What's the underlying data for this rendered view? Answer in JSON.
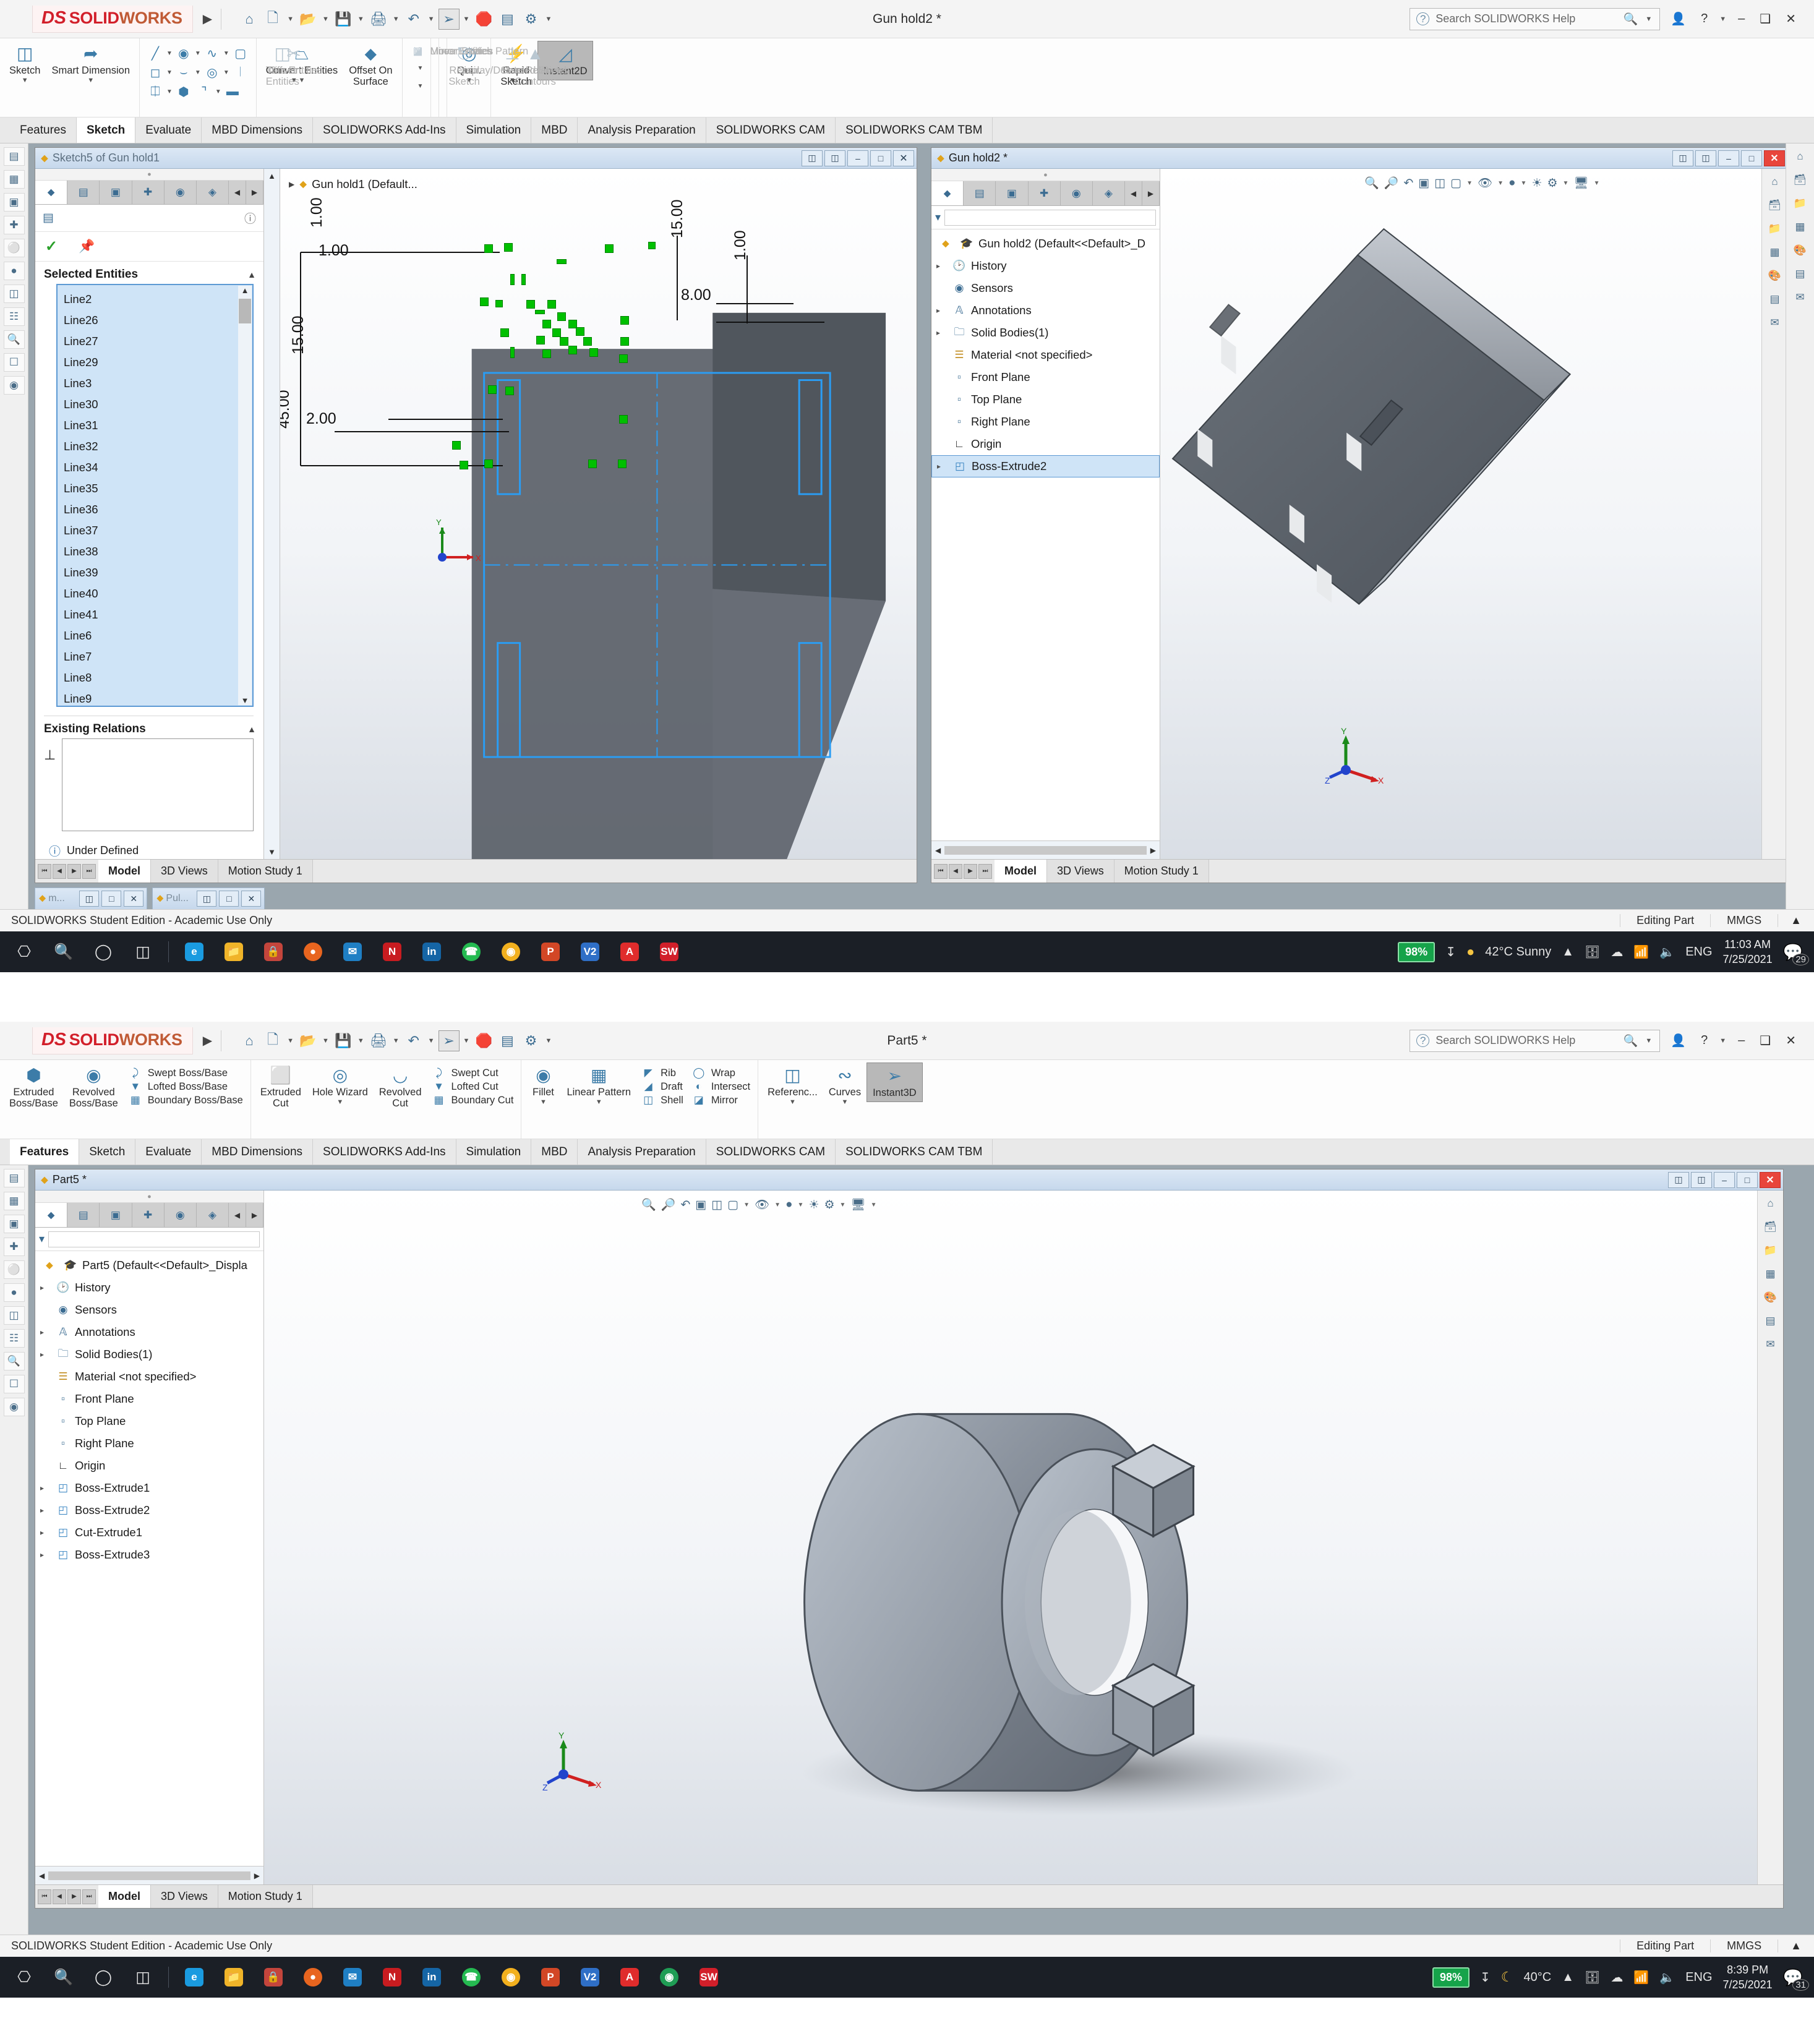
{
  "app": {
    "brand_ds": "DS",
    "brand_solid": "SOLID",
    "brand_works": "WORKS",
    "help_placeholder": "Search SOLIDWORKS Help",
    "status_edition": "SOLIDWORKS Student Edition - Academic Use Only",
    "status_editing": "Editing Part",
    "status_units": "MMGS"
  },
  "window_top": {
    "doc_title": "Gun hold2 *",
    "tabs": [
      "Features",
      "Sketch",
      "Evaluate",
      "MBD Dimensions",
      "SOLIDWORKS Add-Ins",
      "Simulation",
      "MBD",
      "Analysis Preparation",
      "SOLIDWORKS CAM",
      "SOLIDWORKS CAM TBM"
    ],
    "selected_tab": "Sketch",
    "ribbon": {
      "sketch": "Sketch",
      "smart_dimension": "Smart Dimension",
      "trim_entities": "Trim Entities",
      "convert_entities": "Convert Entities",
      "offset_entities": "Offset\nEntities",
      "offset_on_surface": "Offset On\nSurface",
      "mirror_entities": "Mirror Entities",
      "linear_sketch_pattern": "Linear Sketch Pattern",
      "move_entities": "Move Entities",
      "display_delete_relations": "Display/Delete Relations",
      "repair_sketch": "Repair\nSketch",
      "quick_snaps": "Qui...",
      "rapid_sketch": "Rapid\nSketch",
      "instant2d": "Instant2D",
      "shaded_sketch_contours": "Shaded Sketch\nContours"
    },
    "property_manager": {
      "window_title": "Sketch5 of Gun hold1",
      "selected_entities_label": "Selected Entities",
      "entities": [
        "Line2",
        "Line26",
        "Line27",
        "Line29",
        "Line3",
        "Line30",
        "Line31",
        "Line32",
        "Line34",
        "Line35",
        "Line36",
        "Line37",
        "Line38",
        "Line39",
        "Line40",
        "Line41",
        "Line6",
        "Line7",
        "Line8",
        "Line9"
      ],
      "existing_relations_label": "Existing Relations",
      "under_defined_label": "Under Defined"
    },
    "right_panel": {
      "window_title": "Gun hold2 *",
      "tree_root": "Gun hold2  (Default<<Default>_D",
      "tree": [
        {
          "label": "History",
          "expandable": true
        },
        {
          "label": "Sensors",
          "expandable": false
        },
        {
          "label": "Annotations",
          "expandable": true
        },
        {
          "label": "Solid Bodies(1)",
          "expandable": true
        },
        {
          "label": "Material <not specified>",
          "expandable": false
        },
        {
          "label": "Front Plane",
          "expandable": false
        },
        {
          "label": "Top Plane",
          "expandable": false
        },
        {
          "label": "Right Plane",
          "expandable": false
        },
        {
          "label": "Origin",
          "expandable": false
        },
        {
          "label": "Boss-Extrude2",
          "expandable": true,
          "selected": true
        }
      ]
    },
    "left_partial_tree_root": "Gun hold1  (Default...",
    "doc_tabs": [
      "Model",
      "3D Views",
      "Motion Study 1"
    ],
    "doc_tab_selected": "Model",
    "minimized_windows": [
      "m...",
      "Pul..."
    ],
    "sketch_dimensions": [
      "1.00",
      "1.00",
      "15.00",
      "45.00",
      "2.00",
      "15.00",
      "8.00",
      "1.00"
    ],
    "taskbar": {
      "battery": "98%",
      "weather": "42°C  Sunny",
      "language": "ENG",
      "time": "11:03 AM",
      "date": "7/25/2021",
      "notification_count": "29"
    }
  },
  "window_bottom": {
    "doc_title": "Part5 *",
    "tabs": [
      "Features",
      "Sketch",
      "Evaluate",
      "MBD Dimensions",
      "SOLIDWORKS Add-Ins",
      "Simulation",
      "MBD",
      "Analysis Preparation",
      "SOLIDWORKS CAM",
      "SOLIDWORKS CAM TBM"
    ],
    "selected_tab": "Features",
    "ribbon": {
      "extruded_boss": "Extruded\nBoss/Base",
      "revolved_boss": "Revolved\nBoss/Base",
      "swept_boss": "Swept Boss/Base",
      "lofted_boss": "Lofted Boss/Base",
      "boundary_boss": "Boundary Boss/Base",
      "extruded_cut": "Extruded\nCut",
      "hole_wizard": "Hole Wizard",
      "revolved_cut": "Revolved\nCut",
      "swept_cut": "Swept Cut",
      "lofted_cut": "Lofted Cut",
      "boundary_cut": "Boundary Cut",
      "fillet": "Fillet",
      "linear_pattern": "Linear Pattern",
      "rib": "Rib",
      "draft": "Draft",
      "shell": "Shell",
      "wrap": "Wrap",
      "intersect": "Intersect",
      "mirror": "Mirror",
      "reference_geometry": "Referenc...",
      "curves": "Curves",
      "instant3d": "Instant3D"
    },
    "mdi_title": "Part5 *",
    "tree_root": "Part5  (Default<<Default>_Displa",
    "tree": [
      {
        "label": "History",
        "expandable": true
      },
      {
        "label": "Sensors",
        "expandable": false
      },
      {
        "label": "Annotations",
        "expandable": true
      },
      {
        "label": "Solid Bodies(1)",
        "expandable": true
      },
      {
        "label": "Material <not specified>",
        "expandable": false
      },
      {
        "label": "Front Plane",
        "expandable": false
      },
      {
        "label": "Top Plane",
        "expandable": false
      },
      {
        "label": "Right Plane",
        "expandable": false
      },
      {
        "label": "Origin",
        "expandable": false
      },
      {
        "label": "Boss-Extrude1",
        "expandable": true
      },
      {
        "label": "Boss-Extrude2",
        "expandable": true
      },
      {
        "label": "Cut-Extrude1",
        "expandable": true
      },
      {
        "label": "Boss-Extrude3",
        "expandable": true
      }
    ],
    "doc_tabs": [
      "Model",
      "3D Views",
      "Motion Study 1"
    ],
    "doc_tab_selected": "Model",
    "taskbar": {
      "battery": "98%",
      "weather": "40°C",
      "language": "ENG",
      "time": "8:39 PM",
      "date": "7/25/2021",
      "notification_count": "31"
    }
  },
  "colors": {
    "brand_red": "#d21f2a",
    "accent_blue": "#3c7ca8",
    "selection_blue": "#cfe4f7",
    "sketch_green": "#00c000",
    "model_gray": "#5a6068"
  }
}
